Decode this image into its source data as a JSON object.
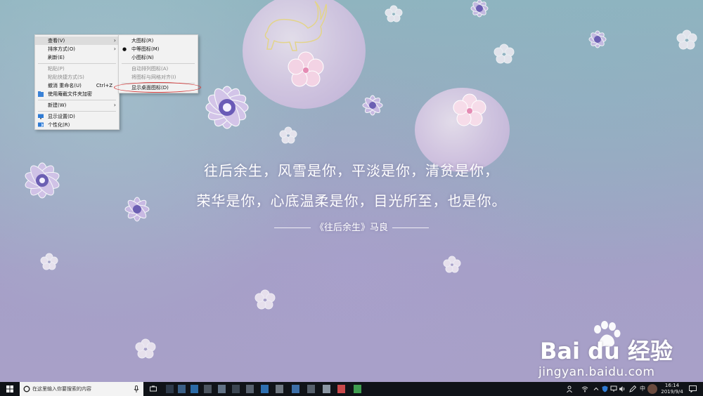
{
  "desktop": {
    "poem": {
      "line1": "往后余生，风雪是你，平淡是你，清贫是你，",
      "line2": "荣华是你，心底温柔是你，目光所至，也是你。",
      "credit": "《往后余生》马良"
    }
  },
  "context_menu": {
    "items": [
      {
        "label": "查看(V)",
        "has_submenu": true,
        "highlighted": true
      },
      {
        "label": "排序方式(O)",
        "has_submenu": true
      },
      {
        "label": "刷新(E)"
      },
      {
        "label": "粘贴(P)",
        "disabled": true
      },
      {
        "label": "粘贴快捷方式(S)",
        "disabled": true
      },
      {
        "label": "撤消 重命名(U)",
        "shortcut": "Ctrl+Z"
      },
      {
        "label": "使用庵截文件夹加密",
        "icon": "shield-folder-icon"
      },
      {
        "label": "新建(W)",
        "has_submenu": true
      },
      {
        "label": "显示设置(D)",
        "icon": "display-icon"
      },
      {
        "label": "个性化(R)",
        "icon": "personalize-icon"
      }
    ]
  },
  "view_submenu": {
    "items": [
      {
        "label": "大图标(R)"
      },
      {
        "label": "中等图标(M)",
        "checked": true
      },
      {
        "label": "小图标(N)"
      },
      {
        "label": "自动排列图标(A)",
        "disabled": true
      },
      {
        "label": "将图标与网格对齐(I)",
        "disabled": true
      },
      {
        "label": "显示桌面图标(D)",
        "circled": true
      }
    ]
  },
  "watermark": {
    "brand": "Bai du 经验",
    "url": "jingyan.baidu.com"
  },
  "taskbar": {
    "search_placeholder": "在这里输入你要搜索的内容",
    "ime_label": "中",
    "time": "16:14",
    "date": "2019/9/4"
  },
  "colors": {
    "menu_bg": "#f2f2f2",
    "highlight": "#dcdcdc",
    "annotation_red": "#d43c3c",
    "taskbar_bg": "#101318"
  }
}
